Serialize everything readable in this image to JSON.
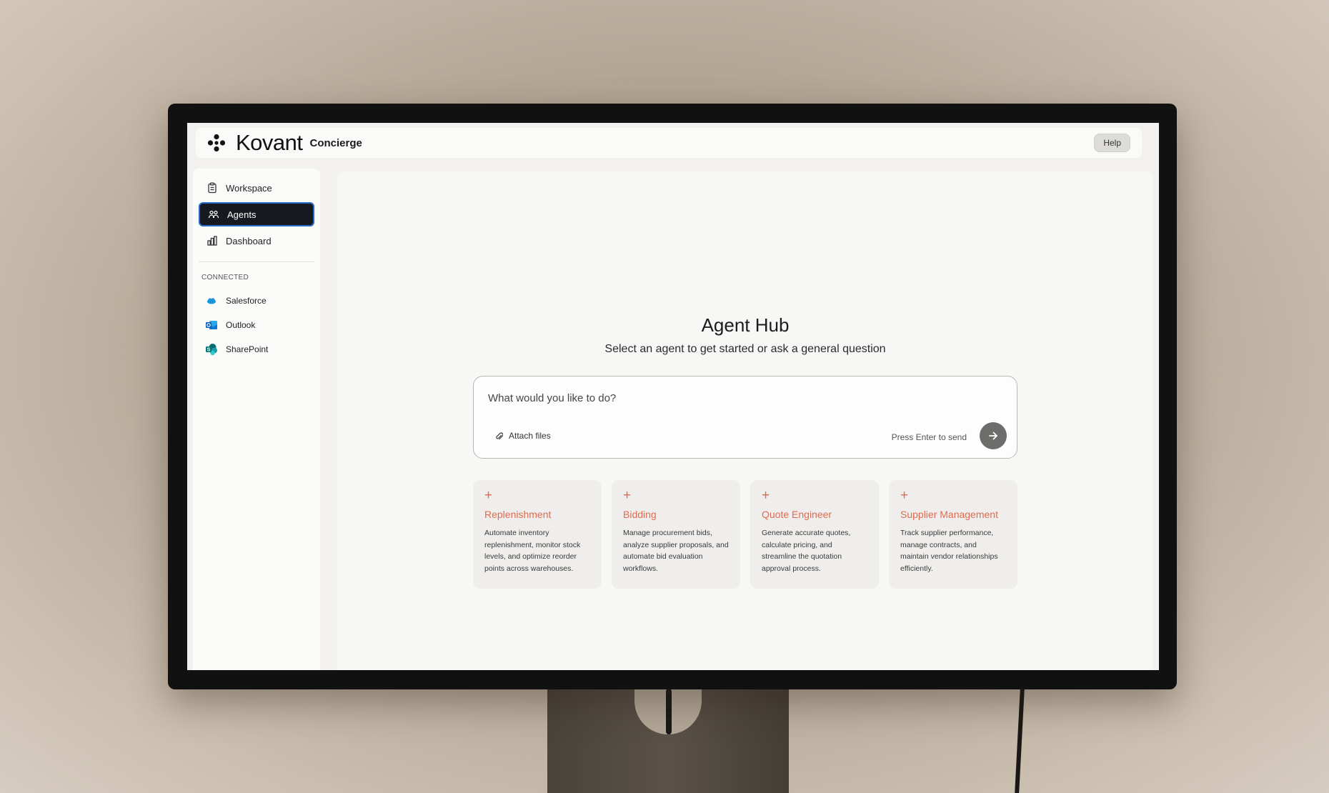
{
  "app": {
    "brand_name": "Kovant",
    "product_name": "Concierge",
    "help_label": "Help"
  },
  "sidebar": {
    "nav": [
      {
        "label": "Workspace",
        "icon": "clipboard-icon",
        "active": false
      },
      {
        "label": "Agents",
        "icon": "agents-icon",
        "active": true
      },
      {
        "label": "Dashboard",
        "icon": "bar-chart-icon",
        "active": false
      }
    ],
    "connected_heading": "CONNECTED",
    "connected": [
      {
        "label": "Salesforce",
        "icon": "salesforce-icon",
        "color": "#1b96d8"
      },
      {
        "label": "Outlook",
        "icon": "outlook-icon",
        "color": "#1a6fd0"
      },
      {
        "label": "SharePoint",
        "icon": "sharepoint-icon",
        "color": "#038387"
      }
    ]
  },
  "main": {
    "title": "Agent Hub",
    "subtitle": "Select an agent to get started or ask a general question",
    "prompt": {
      "placeholder": "What would you like to do?",
      "attach_label": "Attach files",
      "enter_hint": "Press Enter to send"
    },
    "cards": [
      {
        "plus": "+",
        "title": "Replenishment",
        "description": "Automate inventory replenishment, monitor stock levels, and optimize reorder points across warehouses."
      },
      {
        "plus": "+",
        "title": "Bidding",
        "description": "Manage procurement bids, analyze supplier proposals, and automate bid evaluation workflows."
      },
      {
        "plus": "+",
        "title": "Quote Engineer",
        "description": "Generate accurate quotes, calculate pricing, and streamline the quotation approval process."
      },
      {
        "plus": "+",
        "title": "Supplier Management",
        "description": "Track supplier performance, manage contracts, and maintain vendor relationships efficiently."
      }
    ]
  },
  "colors": {
    "accent": "#e06a50",
    "active_nav_bg": "#16191f",
    "active_nav_border": "#2a68c8"
  }
}
